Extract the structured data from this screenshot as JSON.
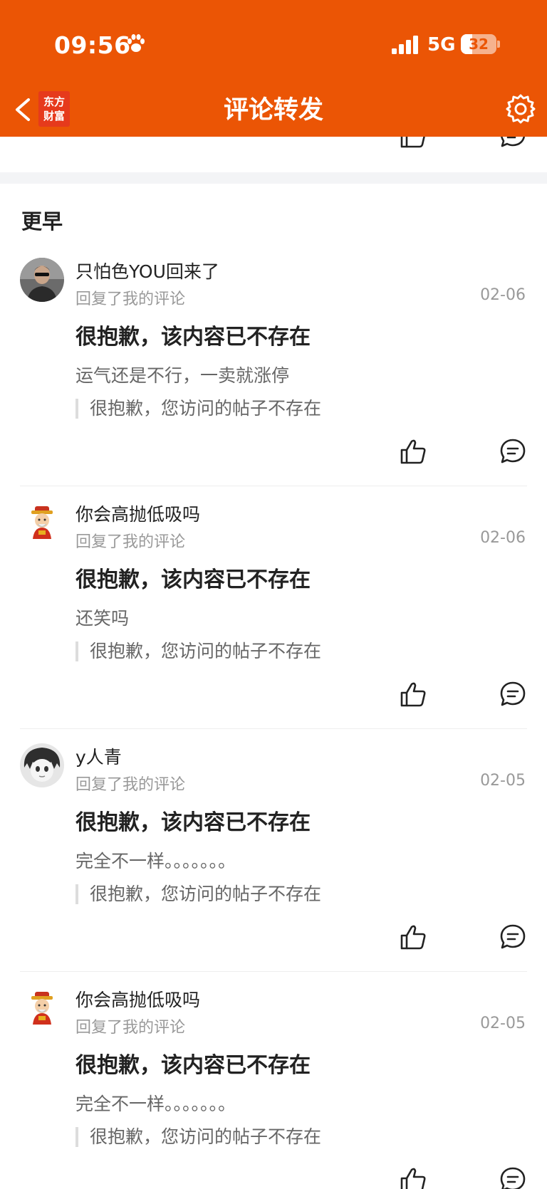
{
  "status_bar": {
    "time": "09:56",
    "network": "5G",
    "battery": "32",
    "battery_level": 0.32
  },
  "nav": {
    "brand_line1": "东方",
    "brand_line2": "财富",
    "title": "评论转发"
  },
  "section": {
    "title": "更早"
  },
  "items": [
    {
      "username": "只怕色YOU回来了",
      "action": "回复了我的评论",
      "date": "02-06",
      "headline": "很抱歉，该内容已不存在",
      "reply": "运气还是不行，一卖就涨停",
      "quote": "很抱歉，您访问的帖子不存在"
    },
    {
      "username": "你会高抛低吸吗",
      "action": "回复了我的评论",
      "date": "02-06",
      "headline": "很抱歉，该内容已不存在",
      "reply": "还笑吗",
      "quote": "很抱歉，您访问的帖子不存在"
    },
    {
      "username": "y人青",
      "action": "回复了我的评论",
      "date": "02-05",
      "headline": "很抱歉，该内容已不存在",
      "reply": "完全不一样。。。。。。。",
      "quote": "很抱歉，您访问的帖子不存在"
    },
    {
      "username": "你会高抛低吸吗",
      "action": "回复了我的评论",
      "date": "02-05",
      "headline": "很抱歉，该内容已不存在",
      "reply": "完全不一样。。。。。。。",
      "quote": "很抱歉，您访问的帖子不存在"
    }
  ],
  "colors": {
    "brand": "#EB5505",
    "muted": "#999999",
    "text": "#222222"
  },
  "icons": {
    "back": "chevron-left-icon",
    "settings": "gear-icon",
    "like": "thumbs-up-icon",
    "comment": "comment-bubble-icon"
  }
}
